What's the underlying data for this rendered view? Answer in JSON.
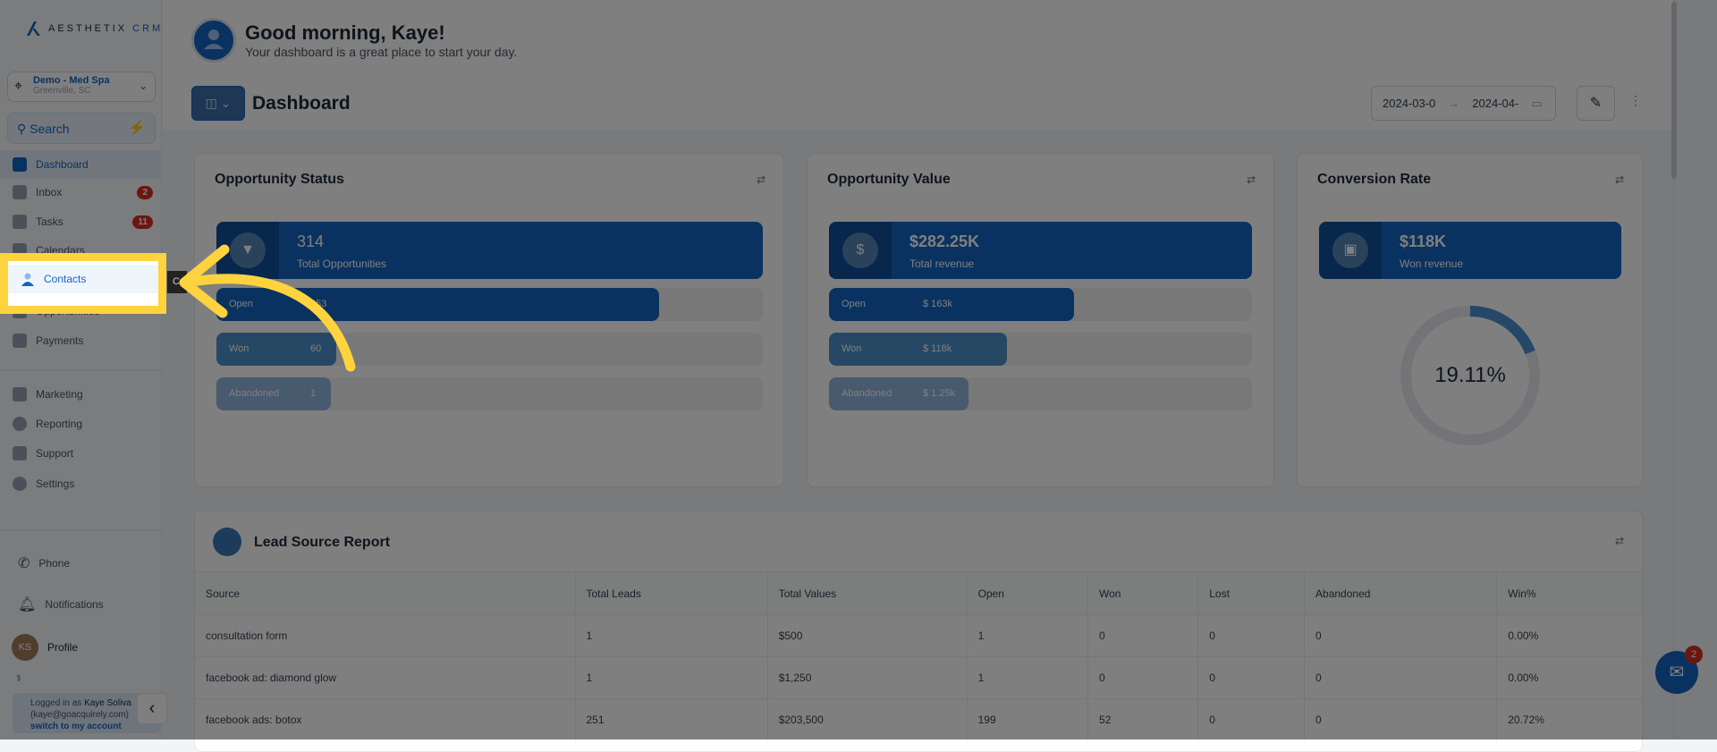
{
  "sidebar": {
    "brand": "AESTHETIX",
    "brand_suffix": "CRM",
    "location": {
      "name": "Demo - Med Spa",
      "city": "Greenville, SC"
    },
    "search_label": "Search",
    "nav": [
      {
        "label": "Dashboard",
        "badge": ""
      },
      {
        "label": "Inbox",
        "badge": "2"
      },
      {
        "label": "Tasks",
        "badge": "11"
      },
      {
        "label": "Calendars",
        "badge": ""
      },
      {
        "label": "Contacts",
        "badge": ""
      },
      {
        "label": "Opportunities",
        "badge": ""
      },
      {
        "label": "Payments",
        "badge": ""
      }
    ],
    "nav2": [
      {
        "label": "Marketing"
      },
      {
        "label": "Reporting"
      },
      {
        "label": "Support"
      },
      {
        "label": "Settings"
      }
    ],
    "phone": "Phone",
    "notifications": "Notifications",
    "profile": "Profile",
    "avatar_initials": "KS",
    "logged_prefix": "Logged in as",
    "logged_name": "Kaye Soliva",
    "logged_email": "(kaye@goacquirely.com)",
    "switch_label": "switch to my account",
    "tooltip": "C"
  },
  "header": {
    "greeting": "Good morning, Kaye!",
    "subtitle": "Your dashboard is a great place to start your day.",
    "page_title": "Dashboard",
    "date_start": "2024-03-0",
    "date_end": "2024-04-"
  },
  "cards": {
    "status": {
      "title": "Opportunity Status",
      "total": "314",
      "total_label": "Total Opportunities",
      "rows": [
        {
          "label": "Open",
          "value": "253",
          "fraction": 0.81
        },
        {
          "label": "Won",
          "value": "60",
          "fraction": 0.22
        },
        {
          "label": "Abandoned",
          "value": "1",
          "fraction": 0.21
        }
      ]
    },
    "value": {
      "title": "Opportunity Value",
      "total": "$282.25K",
      "total_label": "Total revenue",
      "rows": [
        {
          "label": "Open",
          "value": "$ 163k",
          "fraction": 0.58
        },
        {
          "label": "Won",
          "value": "$ 118k",
          "fraction": 0.42
        },
        {
          "label": "Abandoned",
          "value": "$ 1.25k",
          "fraction": 0.33
        }
      ]
    },
    "conversion": {
      "title": "Conversion Rate",
      "total": "$118K",
      "total_label": "Won revenue",
      "rate": "19.11%",
      "rate_value": 19.11
    }
  },
  "lead_report": {
    "title": "Lead Source Report",
    "columns": [
      "Source",
      "Total Leads",
      "Total Values",
      "Open",
      "Won",
      "Lost",
      "Abandoned",
      "Win%"
    ],
    "rows": [
      [
        "consultation form",
        "1",
        "$500",
        "1",
        "0",
        "0",
        "0",
        "0.00%"
      ],
      [
        "facebook ad: diamond glow",
        "1",
        "$1,250",
        "1",
        "0",
        "0",
        "0",
        "0.00%"
      ],
      [
        "facebook ads: botox",
        "251",
        "$203,500",
        "199",
        "52",
        "0",
        "0",
        "20.72%"
      ]
    ]
  },
  "chat": {
    "badge": "2"
  },
  "colors": {
    "primary": "#1565c0",
    "highlight": "#fed33e",
    "badge": "#d92d20"
  }
}
